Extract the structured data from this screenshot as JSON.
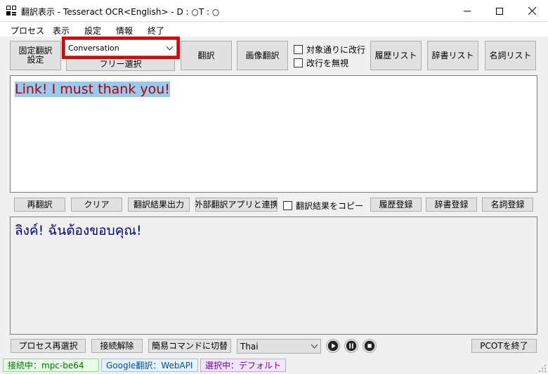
{
  "window": {
    "title": "翻訳表示 - Tesseract OCR<English> - D : ○T : ○",
    "min_icon": "minimize-icon",
    "max_icon": "maximize-icon",
    "close_icon": "close-icon"
  },
  "menu": [
    "プロセス",
    "表示",
    "設定",
    "情報",
    "終了"
  ],
  "toolbar": {
    "fixed_translation_line1": "固定翻訳",
    "fixed_translation_line2": "設定",
    "mode_selected": "Conversation",
    "free_select": "フリー選択",
    "translate": "翻訳",
    "image_translate": "画像翻訳",
    "check_newline": "対象通りに改行",
    "check_ignore_newline": "改行を無視",
    "history_list": "履歴リスト",
    "dictionary_list": "辞書リスト",
    "noun_list": "名詞リスト"
  },
  "source_text": "Link! I must thank you!",
  "action_bar": {
    "retranslate": "再翻訳",
    "clear": "クリア",
    "output_result": "翻訳結果出力",
    "external_app": "外部翻訳アプリと連携",
    "copy_result": "翻訳結果をコピー",
    "register_history": "履歴登録",
    "register_dictionary": "辞書登録",
    "register_noun": "名詞登録"
  },
  "translated_text": "ลิงค์! ฉันต้องขอบคุณ!",
  "bottom_bar": {
    "reselect_process": "プロセス再選択",
    "disconnect": "接続解除",
    "simple_command": "簡易コマンドに切替",
    "language_selected": "Thai",
    "exit_pcot": "PCOTを終了"
  },
  "status": {
    "connection": "接続中：mpc-be64",
    "engine": "Google翻訳：WebAPI",
    "selection": "選択中：デフォルト"
  },
  "colors": {
    "source_text": "#b00000",
    "source_highlight": "#99c9ef",
    "translated_text": "#00008b",
    "highlight_border": "#e00000",
    "status_connection_bg": "#e6ffe6",
    "status_engine_bg": "#e6f3ff",
    "status_selection_bg": "#f0e6ff"
  }
}
